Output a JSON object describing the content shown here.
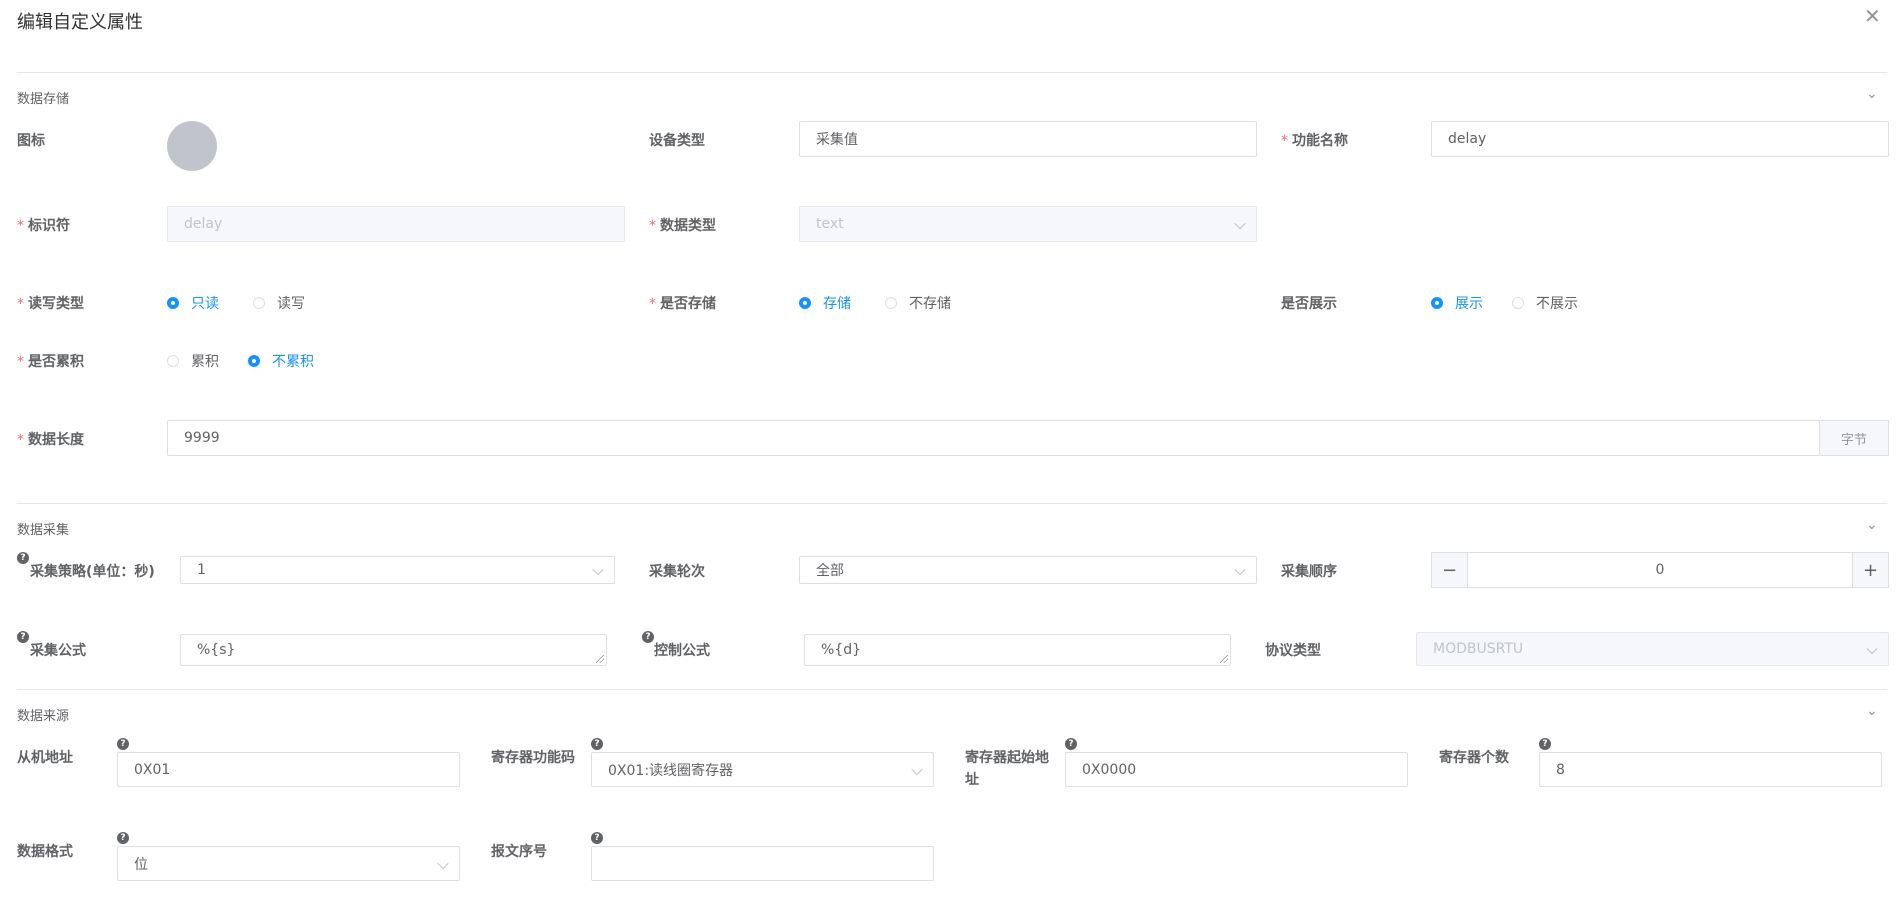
{
  "dialog": {
    "title": "编辑自定义属性",
    "close_icon": "close-icon"
  },
  "sections": {
    "storage": "数据存储",
    "collect": "数据采集",
    "source": "数据来源"
  },
  "storage": {
    "icon_label": "图标",
    "device_type_label": "设备类型",
    "device_type_value": "采集值",
    "func_name_label": "功能名称",
    "func_name_value": "delay",
    "identifier_label": "标识符",
    "identifier_value": "delay",
    "data_type_label": "数据类型",
    "data_type_value": "text",
    "rw_label": "读写类型",
    "rw_options": [
      "只读",
      "读写"
    ],
    "rw_selected": "只读",
    "store_label": "是否存储",
    "store_options": [
      "存储",
      "不存储"
    ],
    "store_selected": "存储",
    "show_label": "是否展示",
    "show_options": [
      "展示",
      "不展示"
    ],
    "show_selected": "展示",
    "accum_label": "是否累积",
    "accum_options": [
      "累积",
      "不累积"
    ],
    "accum_selected": "不累积",
    "length_label": "数据长度",
    "length_value": "9999",
    "length_unit": "字节"
  },
  "collect": {
    "strategy_label": "采集策略(单位：秒)",
    "strategy_value": "1",
    "round_label": "采集轮次",
    "round_value": "全部",
    "order_label": "采集顺序",
    "order_value": "0",
    "minus": "−",
    "plus": "+",
    "formula_label": "采集公式",
    "formula_value": "%{s}",
    "control_label": "控制公式",
    "control_value": "%{d}",
    "protocol_label": "协议类型",
    "protocol_value": "MODBUSRTU"
  },
  "source": {
    "slave_label": "从机地址",
    "slave_value": "0X01",
    "func_code_label": "寄存器功能码",
    "func_code_value": "0X01:读线圈寄存器",
    "start_label_1": "寄存器起始地",
    "start_label_2": "址",
    "start_value": "0X0000",
    "count_label": "寄存器个数",
    "count_value": "8",
    "format_label": "数据格式",
    "format_value": "位",
    "msg_label": "报文序号",
    "msg_value": ""
  },
  "help_glyph": "?",
  "required_mark": "*",
  "colors": {
    "primary": "#1890ff",
    "required": "#f56c6c",
    "border": "#dcdfe6"
  }
}
